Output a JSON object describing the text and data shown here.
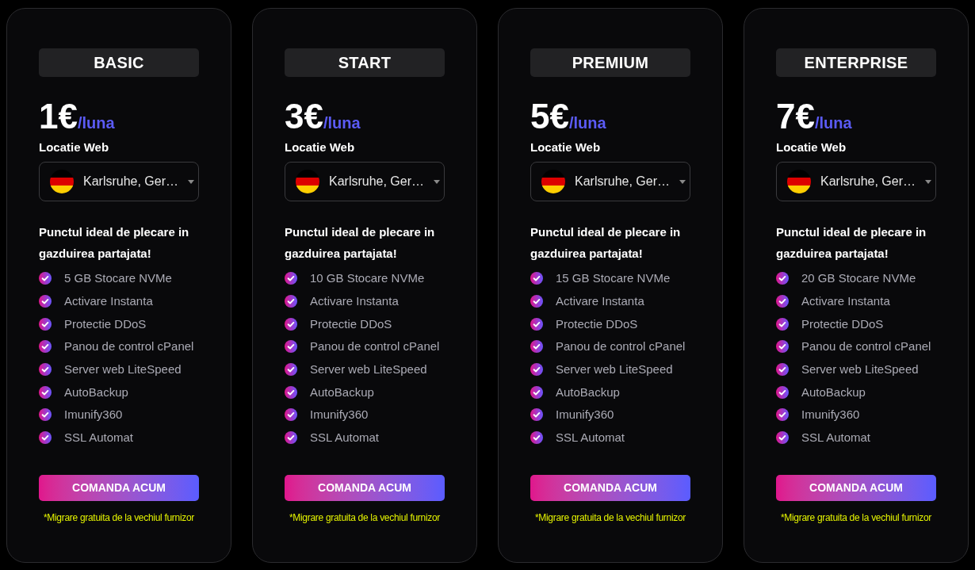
{
  "plans": [
    {
      "name": "BASIC",
      "price": "1€",
      "period": "/luna",
      "location_label": "Locatie Web",
      "location": {
        "value": "Karlsruhe, Ger…"
      },
      "description": "Punctul ideal de plecare in gazduirea partajata!",
      "features": [
        "5 GB Stocare NVMe",
        "Activare Instanta",
        "Protectie DDoS",
        "Panou de control cPanel",
        "Server web LiteSpeed",
        "AutoBackup",
        "Imunify360",
        "SSL Automat"
      ],
      "button": "COMANDA ACUM",
      "note": "*Migrare gratuita de la vechiul furnizor"
    },
    {
      "name": "START",
      "price": "3€",
      "period": "/luna",
      "location_label": "Locatie Web",
      "location": {
        "value": "Karlsruhe, Ger…"
      },
      "description": "Punctul ideal de plecare in gazduirea partajata!",
      "features": [
        "10 GB Stocare NVMe",
        "Activare Instanta",
        "Protectie DDoS",
        "Panou de control cPanel",
        "Server web LiteSpeed",
        "AutoBackup",
        "Imunify360",
        "SSL Automat"
      ],
      "button": "COMANDA ACUM",
      "note": "*Migrare gratuita de la vechiul furnizor"
    },
    {
      "name": "PREMIUM",
      "price": "5€",
      "period": "/luna",
      "location_label": "Locatie Web",
      "location": {
        "value": "Karlsruhe, Ger…"
      },
      "description": "Punctul ideal de plecare in gazduirea partajata!",
      "features": [
        "15 GB Stocare NVMe",
        "Activare Instanta",
        "Protectie DDoS",
        "Panou de control cPanel",
        "Server web LiteSpeed",
        "AutoBackup",
        "Imunify360",
        "SSL Automat"
      ],
      "button": "COMANDA ACUM",
      "note": "*Migrare gratuita de la vechiul furnizor"
    },
    {
      "name": "ENTERPRISE",
      "price": "7€",
      "period": "/luna",
      "location_label": "Locatie Web",
      "location": {
        "value": "Karlsruhe, Ger…"
      },
      "description": "Punctul ideal de plecare in gazduirea partajata!",
      "features": [
        "20 GB Stocare NVMe",
        "Activare Instanta",
        "Protectie DDoS",
        "Panou de control cPanel",
        "Server web LiteSpeed",
        "AutoBackup",
        "Imunify360",
        "SSL Automat"
      ],
      "button": "COMANDA ACUM",
      "note": "*Migrare gratuita de la vechiul furnizor"
    }
  ]
}
